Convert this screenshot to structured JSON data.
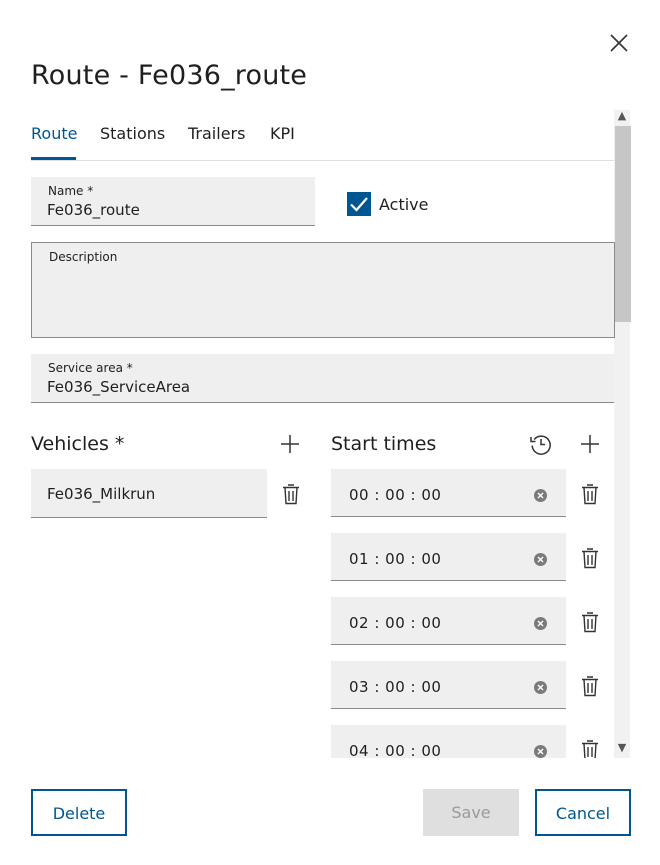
{
  "dialog": {
    "title": "Route - Fe036_route"
  },
  "tabs": [
    {
      "label": "Route",
      "active": true
    },
    {
      "label": "Stations"
    },
    {
      "label": "Trailers"
    },
    {
      "label": "KPI"
    }
  ],
  "form": {
    "name": {
      "label": "Name *",
      "value": "Fe036_route"
    },
    "active": {
      "label": "Active",
      "checked": true
    },
    "description": {
      "label": "Description",
      "value": ""
    },
    "service_area": {
      "label": "Service area *",
      "value": "Fe036_ServiceArea"
    }
  },
  "vehicles": {
    "title": "Vehicles *",
    "items": [
      "Fe036_Milkrun"
    ]
  },
  "start_times": {
    "title": "Start times",
    "items": [
      "00 : 00 : 00",
      "01 : 00 : 00",
      "02 : 00 : 00",
      "03 : 00 : 00",
      "04 : 00 : 00"
    ]
  },
  "buttons": {
    "delete": "Delete",
    "save": "Save",
    "cancel": "Cancel"
  },
  "colors": {
    "accent": "#005691",
    "field_bg": "#efefef",
    "disabled_bg": "#dfdfdf"
  },
  "icons": {
    "close": "close-icon",
    "add": "plus-icon",
    "delete": "trash-icon",
    "history": "history-icon",
    "clear": "clear-circle-icon",
    "check": "checkmark-icon"
  }
}
